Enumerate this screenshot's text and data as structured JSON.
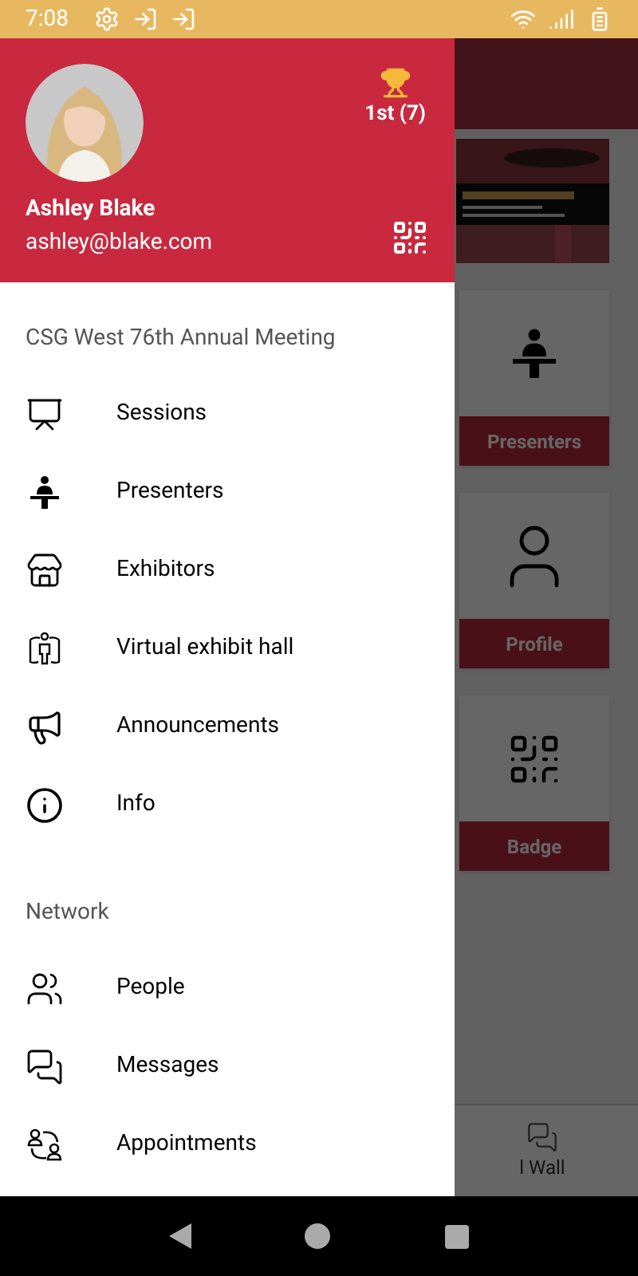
{
  "status_bar": {
    "time": "7:08"
  },
  "background": {
    "cards": [
      {
        "label": "Presenters"
      },
      {
        "label": "Profile"
      },
      {
        "label": "Badge"
      }
    ],
    "bottom_nav": {
      "label": "l Wall"
    }
  },
  "drawer": {
    "user": {
      "name": "Ashley Blake",
      "email": "ashley@blake.com",
      "rank": "1st (7)"
    },
    "sections": [
      {
        "title": "CSG West 76th Annual Meeting",
        "items": [
          {
            "label": "Sessions"
          },
          {
            "label": "Presenters"
          },
          {
            "label": "Exhibitors"
          },
          {
            "label": "Virtual exhibit hall"
          },
          {
            "label": "Announcements"
          },
          {
            "label": "Info"
          }
        ]
      },
      {
        "title": "Network",
        "items": [
          {
            "label": "People"
          },
          {
            "label": "Messages"
          },
          {
            "label": "Appointments"
          }
        ]
      }
    ]
  }
}
